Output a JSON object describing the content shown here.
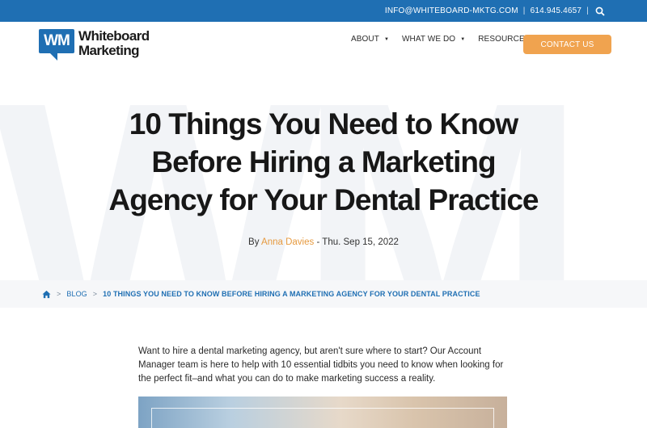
{
  "topbar": {
    "email": "INFO@WHITEBOARD-MKTG.COM",
    "phone": "614.945.4657",
    "separator": "|",
    "background": "#1f6fb3",
    "search_icon": "search-icon"
  },
  "logo": {
    "badge": "WM",
    "line1": "Whiteboard",
    "line2": "Marketing"
  },
  "nav": {
    "items": [
      {
        "label": "ABOUT"
      },
      {
        "label": "WHAT WE DO"
      },
      {
        "label": "RESOURCES"
      }
    ],
    "caret": "▼",
    "contact_label": "CONTACT US",
    "contact_color": "#f0a34f"
  },
  "watermark": "WM",
  "article": {
    "title_line1": "10 Things You Need to Know",
    "title_line2": "Before Hiring a Marketing",
    "title_line3": "Agency for Your Dental Practice",
    "by": "By",
    "author": "Anna Davies",
    "date_sep": "-",
    "date": "Thu. Sep 15, 2022",
    "intro": "Want to hire a dental marketing agency, but aren't sure where to start? Our Account Manager team is here to help with 10 essential tidbits you need to know when looking for the perfect fit–and what you can do to make marketing success a reality."
  },
  "breadcrumb": {
    "home_icon": "home-icon",
    "sep": ">",
    "blog": "BLOG",
    "current": "10 THINGS YOU NEED TO KNOW BEFORE HIRING A MARKETING AGENCY FOR YOUR DENTAL PRACTICE"
  }
}
